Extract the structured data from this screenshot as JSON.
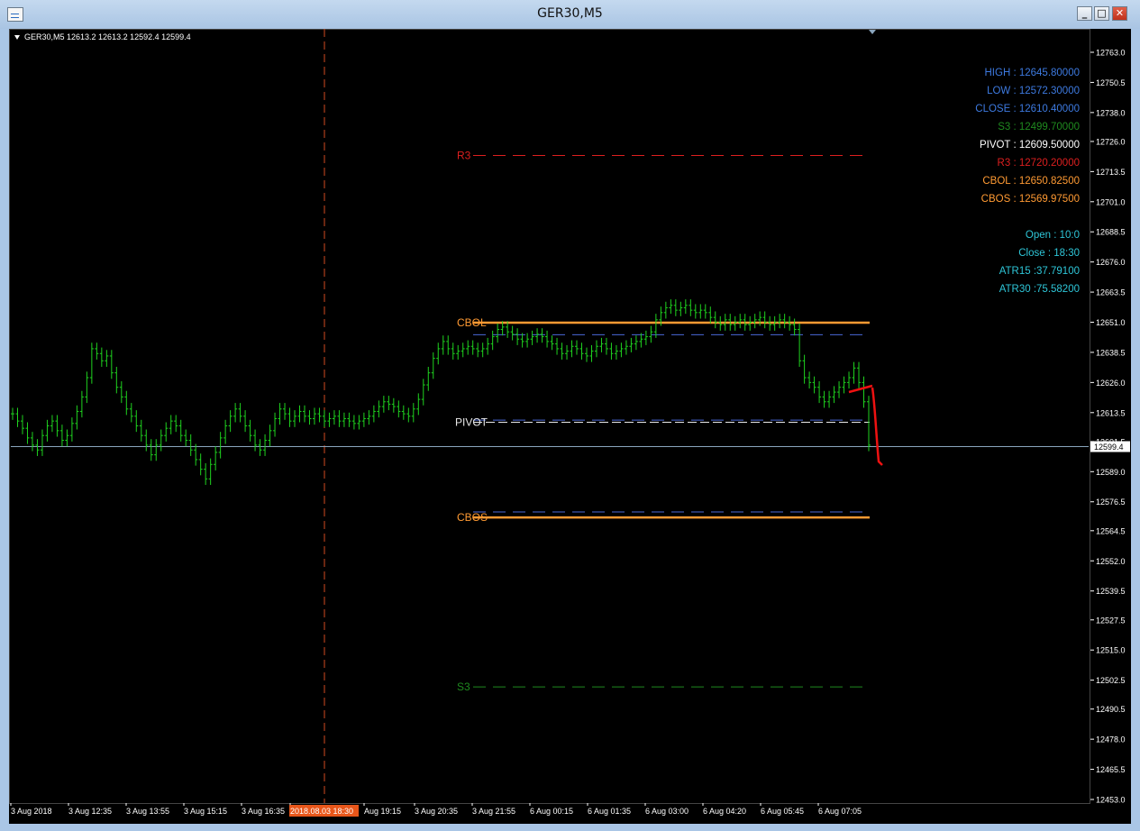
{
  "window": {
    "title": "GER30,M5"
  },
  "chart_header": {
    "text": "GER30,M5  12613.2 12613.2 12592.4 12599.4"
  },
  "info_panel": [
    {
      "text": "HIGH : 12645.80000",
      "color": "#3d7ae0"
    },
    {
      "text": "LOW : 12572.30000",
      "color": "#3d7ae0"
    },
    {
      "text": "CLOSE : 12610.40000",
      "color": "#3d7ae0"
    },
    {
      "text": "S3 : 12499.70000",
      "color": "#1f8a1f"
    },
    {
      "text": "PIVOT : 12609.50000",
      "color": "#ffffff"
    },
    {
      "text": "R3 : 12720.20000",
      "color": "#dd1f1f"
    },
    {
      "text": "CBOL : 12650.82500",
      "color": "#ff9a33"
    },
    {
      "text": "CBOS : 12569.97500",
      "color": "#ff9a33"
    }
  ],
  "time_panel": [
    {
      "text": "Open : 10:0",
      "color": "#2ec6d8"
    },
    {
      "text": "Close : 18:30",
      "color": "#2ec6d8"
    },
    {
      "text": "ATR15 :37.79100",
      "color": "#2ec6d8"
    },
    {
      "text": "ATR30 :75.58200",
      "color": "#2ec6d8"
    }
  ],
  "colors": {
    "candles": "#1fd21f",
    "background": "#000000",
    "grid_text": "#ffffff",
    "current_line": "#8aa5bd",
    "separator": "#d24a1f",
    "highlight_time": "#e8561a"
  },
  "chart_data": {
    "type": "line",
    "title": "",
    "xlabel": "",
    "ylabel": "",
    "ylim": [
      12453.0,
      12763.0
    ],
    "y_ticks": [
      "12763.0",
      "12750.5",
      "12738.0",
      "12726.0",
      "12713.5",
      "12701.0",
      "12688.5",
      "12676.0",
      "12663.5",
      "12651.0",
      "12638.5",
      "12626.0",
      "12613.5",
      "12601.5",
      "12589.0",
      "12576.5",
      "12564.5",
      "12552.0",
      "12539.5",
      "12527.5",
      "12515.0",
      "12502.5",
      "12490.5",
      "12478.0",
      "12465.5",
      "12453.0"
    ],
    "current_price": "12599.4",
    "x_ticks": [
      "3 Aug 2018",
      "3 Aug 12:35",
      "3 Aug 13:55",
      "3 Aug 15:15",
      "3 Aug 16:35",
      "2018.08.03 18:30",
      "Aug 19:15",
      "3 Aug 20:35",
      "3 Aug 21:55",
      "6 Aug 00:15",
      "6 Aug 01:35",
      "6 Aug 03:00",
      "6 Aug 04:20",
      "6 Aug 05:45",
      "6 Aug 07:05"
    ],
    "highlight_tick": "2018.08.03 18:30",
    "levels": [
      {
        "name": "R3",
        "value": 12720.2,
        "color": "#dd1f1f",
        "style": "dash",
        "label": "R3"
      },
      {
        "name": "CBOL",
        "value": 12650.8,
        "color": "#ff9a33",
        "style": "solid",
        "label": "CBOL"
      },
      {
        "name": "HIGH",
        "value": 12645.8,
        "color": "#4a68d8",
        "style": "dash",
        "label": ""
      },
      {
        "name": "CLOSE",
        "value": 12610.4,
        "color": "#4a68d8",
        "style": "dash",
        "label": ""
      },
      {
        "name": "PIVOT",
        "value": 12609.5,
        "color": "#e8e8e8",
        "style": "dash",
        "label": "PIVOT"
      },
      {
        "name": "LOW",
        "value": 12572.3,
        "color": "#4a68d8",
        "style": "dash",
        "label": ""
      },
      {
        "name": "CBOS",
        "value": 12570.0,
        "color": "#ff9a33",
        "style": "solid",
        "label": "CBOS"
      },
      {
        "name": "S3",
        "value": 12499.7,
        "color": "#1f8a1f",
        "style": "dash",
        "label": "S3"
      }
    ],
    "series": [
      {
        "values": [
          12613,
          12610,
          12607,
          12603,
          12600,
          12598,
          12604,
          12608,
          12610,
          12606,
          12602,
          12604,
          12609,
          12614,
          12620,
          12628,
          12640,
          12638,
          12635,
          12637,
          12630,
          12624,
          12620,
          12615,
          12612,
          12608,
          12604,
          12600,
          12596,
          12600,
          12604,
          12607,
          12610,
          12608,
          12604,
          12602,
          12598,
          12594,
          12590,
          12586,
          12592,
          12597,
          12603,
          12608,
          12612,
          12615,
          12612,
          12608,
          12604,
          12600,
          12598,
          12602,
          12606,
          12611,
          12615,
          12613,
          12610,
          12612,
          12614,
          12612,
          12611,
          12613,
          12612,
          12610,
          12611,
          12612,
          12610,
          12611,
          12610,
          12609,
          12610,
          12611,
          12612,
          12614,
          12616,
          12618,
          12617,
          12616,
          12614,
          12613,
          12612,
          12615,
          12619,
          12625,
          12630,
          12636,
          12640,
          12643,
          12640,
          12638,
          12639,
          12640,
          12641,
          12640,
          12639,
          12640,
          12642,
          12645,
          12648,
          12649,
          12647,
          12646,
          12644,
          12643,
          12644,
          12645,
          12646,
          12645,
          12643,
          12642,
          12640,
          12638,
          12639,
          12641,
          12640,
          12638,
          12637,
          12639,
          12641,
          12642,
          12640,
          12638,
          12639,
          12640,
          12641,
          12642,
          12643,
          12644,
          12645,
          12647,
          12652,
          12655,
          12657,
          12658,
          12656,
          12657,
          12658,
          12656,
          12655,
          12656,
          12655,
          12653,
          12651,
          12650,
          12652,
          12650,
          12651,
          12652,
          12650,
          12651,
          12652,
          12653,
          12651,
          12650,
          12651,
          12652,
          12651,
          12650,
          12648,
          12635,
          12628,
          12626,
          12624,
          12620,
          12618,
          12620,
          12622,
          12624,
          12626,
          12628,
          12632,
          12626,
          12618,
          12600
        ]
      }
    ]
  }
}
